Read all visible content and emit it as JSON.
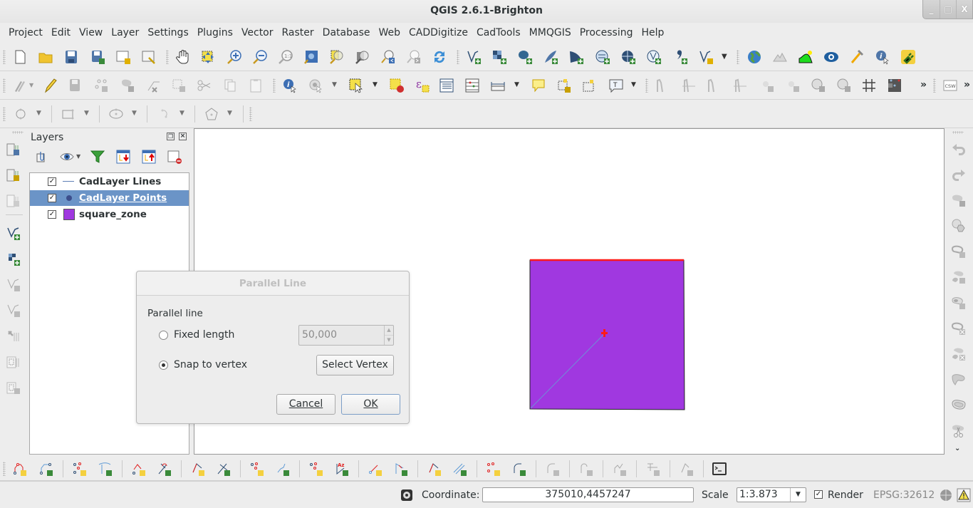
{
  "window": {
    "title": "QGIS 2.6.1-Brighton",
    "controls": {
      "minimize": "_",
      "maximize": "□",
      "close": "X"
    }
  },
  "menubar": {
    "items": [
      {
        "label": "Project"
      },
      {
        "label": "Edit"
      },
      {
        "label": "View"
      },
      {
        "label": "Layer"
      },
      {
        "label": "Settings"
      },
      {
        "label": "Plugins"
      },
      {
        "label": "Vector"
      },
      {
        "label": "Raster"
      },
      {
        "label": "Database"
      },
      {
        "label": "Web"
      },
      {
        "label": "CADDigitize"
      },
      {
        "label": "CadTools"
      },
      {
        "label": "MMQGIS"
      },
      {
        "label": "Processing"
      },
      {
        "label": "Help"
      }
    ]
  },
  "toolbars": {
    "row1": [
      "new-project",
      "open-project",
      "save-project",
      "save-as",
      "new-print-composer",
      "composer-manager",
      "pan",
      "pan-to-selection",
      "zoom-in",
      "zoom-out",
      "zoom-native",
      "zoom-full",
      "zoom-to-selection",
      "zoom-to-layer",
      "zoom-last",
      "zoom-next",
      "refresh",
      "add-vector-layer",
      "add-raster-layer",
      "add-postgis-layer",
      "add-spatialite-layer",
      "add-mssql-layer",
      "add-wms-layer",
      "add-wcs-layer",
      "add-wfs-layer",
      "add-delimited-text-layer",
      "new-shapefile-layer",
      "openlayers-plugin",
      "terrain",
      "raster-terrain",
      "globe",
      "plugin-builder",
      "identify-plugin",
      "plugin-reloader"
    ],
    "row2": [
      "toggle-editing-multi",
      "toggle-editing",
      "save-edits",
      "add-feature",
      "move-feature",
      "node-tool",
      "delete-selected",
      "cut-features",
      "copy-features",
      "paste-features",
      "identify",
      "run-action",
      "select-features",
      "deselect",
      "select-by-expression",
      "attribute-table",
      "field-calculator",
      "measure-line",
      "text-annotation",
      "move-label",
      "pin-label",
      "text-annotation-2",
      "histogram-1",
      "histogram-2",
      "histogram-3",
      "histogram-4",
      "sun-up",
      "sun-down",
      "lens-up",
      "lens-down",
      "grid",
      "raster-points",
      "more",
      "csw"
    ],
    "overflow_label": "»",
    "csw_label": "CSW"
  },
  "layers_panel": {
    "title": "Layers",
    "layers": [
      {
        "name": "CadLayer Lines",
        "checked": true,
        "symbol": "line",
        "color": "#5e7fb5",
        "selected": false
      },
      {
        "name": "CadLayer Points",
        "checked": true,
        "symbol": "point",
        "color": "#3c4e8c",
        "selected": true
      },
      {
        "name": "square_zone",
        "checked": true,
        "symbol": "fill",
        "color": "#a038e0",
        "selected": false
      }
    ]
  },
  "dialog": {
    "title": "Parallel Line",
    "group_label": "Parallel line",
    "options": [
      {
        "label": "Fixed length",
        "selected": false
      },
      {
        "label": "Snap to vertex",
        "selected": true
      }
    ],
    "length_value": "50,000",
    "select_vertex_label": "Select Vertex",
    "cancel_label": "Cancel",
    "ok_label": "OK"
  },
  "map": {
    "polygon_fill": "#a038e0",
    "highlight_edge_color": "#ff0000",
    "vertex_marker_color": "#ff0000",
    "rubberband_color": "#6f8fd6"
  },
  "statusbar": {
    "coordinate_label": "Coordinate:",
    "coordinate_value": "375010,4457247",
    "scale_label": "Scale",
    "scale_value": "1:3.873",
    "render_label": "Render",
    "render_checked": true,
    "crs": "EPSG:32612"
  }
}
